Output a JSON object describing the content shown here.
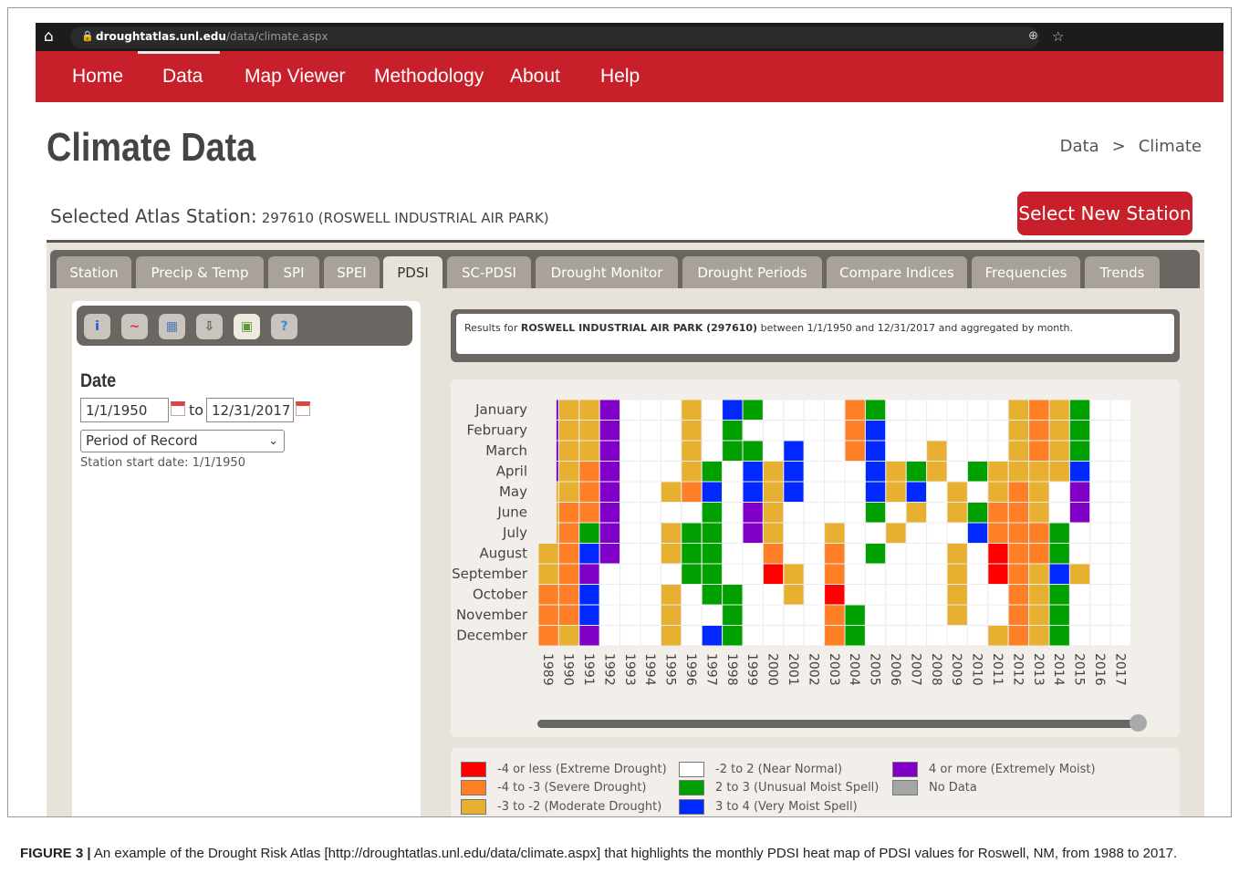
{
  "browser": {
    "url_host": "droughtatlas.unl.edu",
    "url_path": "/data/climate.aspx"
  },
  "nav": [
    "Home",
    "Data",
    "Map Viewer",
    "Methodology",
    "About",
    "Help"
  ],
  "page": {
    "title": "Climate Data",
    "breadcrumb": [
      "Data",
      ">",
      "Climate"
    ]
  },
  "station": {
    "label": "Selected Atlas Station:",
    "value": "297610 (ROSWELL INDUSTRIAL AIR PARK)",
    "button": "Select New Station"
  },
  "tabs": [
    "Station",
    "Precip & Temp",
    "SPI",
    "SPEI",
    "PDSI",
    "SC-PDSI",
    "Drought Monitor",
    "Drought Periods",
    "Compare Indices",
    "Frequencies",
    "Trends"
  ],
  "active_tab": "PDSI",
  "toolbar": [
    "i",
    "~",
    "▦",
    "⇩",
    "▣",
    "?"
  ],
  "date_form": {
    "heading": "Date",
    "from": "1/1/1950",
    "to_label": "to",
    "to": "12/31/2017",
    "period": "Period of Record",
    "start_note": "Station start date: 1/1/1950"
  },
  "results": {
    "prefix": "Results for",
    "station": "ROSWELL INDUSTRIAL AIR PARK (297610)",
    "suffix": "between 1/1/1950 and 12/31/2017 and aggregated by month."
  },
  "chart_data": {
    "type": "heatmap",
    "x_labels": [
      "1989",
      "1990",
      "1991",
      "1992",
      "1993",
      "1994",
      "1995",
      "1996",
      "1997",
      "1998",
      "1999",
      "2000",
      "2001",
      "2002",
      "2003",
      "2004",
      "2005",
      "2006",
      "2007",
      "2008",
      "2009",
      "2010",
      "2011",
      "2012",
      "2013",
      "2014",
      "2015",
      "2016",
      "2017"
    ],
    "y_labels": [
      "January",
      "February",
      "March",
      "April",
      "May",
      "June",
      "July",
      "August",
      "September",
      "October",
      "November",
      "December"
    ],
    "category_colors": {
      "E": "#ff0000",
      "S": "#ff7f27",
      "M": "#e8b030",
      "N": "#ffffff",
      "U": "#00a000",
      "V": "#0028ff",
      "X": "#8000c8",
      "D": "#a6a6a6"
    },
    "partial_first_column_months": [
      "January",
      "February",
      "March",
      "April",
      "May",
      "June",
      "July"
    ],
    "rows": [
      "XMMXNNNMNVUNNNNSUNNNNNNMSMUNN",
      "XMMXNNNMNUNNNNNSVNNNNNNMSMUNN",
      "XMMXNNNMNUUNVNNSVNNMNNNMSMUNN",
      "XMSXNNNMUNVMVNNNVMUMNUMMMMVNN",
      "MMSXNNMSVNVMVNNNVMVNMNMSMNXNN",
      "MSSXNNNNUNXMNNNNUNMNMUSSMNXNN",
      "MSUXNNMUUNXMNNMNNMNNNVSSSUNNN",
      "MSVXNNMUUNNSNNSNUNNNMNESSUNNN",
      "MSXNNNNUUNNEMNSNNNNNMNESMVMNN",
      "SSVNNNMNUUNNMNENNNNNMNNSMUNNN",
      "SSVNNNMNNUNNNNSUNNNNMNNSMUNNN",
      "SMXNNNMNVUNNNNSUNNNNNNMSMUNNN"
    ]
  },
  "legend": [
    {
      "label": "-4 or less (Extreme Drought)",
      "color": "#ff0000"
    },
    {
      "label": "-4 to -3 (Severe Drought)",
      "color": "#ff7f27"
    },
    {
      "label": "-3 to -2 (Moderate Drought)",
      "color": "#e8b030"
    },
    {
      "label": "-2 to 2 (Near Normal)",
      "color": "#ffffff"
    },
    {
      "label": "2 to 3 (Unusual Moist Spell)",
      "color": "#00a000"
    },
    {
      "label": "3 to 4 (Very Moist Spell)",
      "color": "#0028ff"
    },
    {
      "label": "4 or more (Extremely Moist)",
      "color": "#8000c8"
    },
    {
      "label": "No Data",
      "color": "#a6a6a6"
    }
  ],
  "caption": {
    "label": "FIGURE 3 |",
    "text": "An example of the Drought Risk Atlas [http://droughtatlas.unl.edu/data/climate.aspx] that highlights the monthly PDSI heat map of PDSI values for Roswell, NM, from 1988 to 2017."
  },
  "colors": {
    "nav_red": "#c8202b",
    "panel_dark": "#6b6661",
    "tab_gray": "#a9a29b"
  }
}
